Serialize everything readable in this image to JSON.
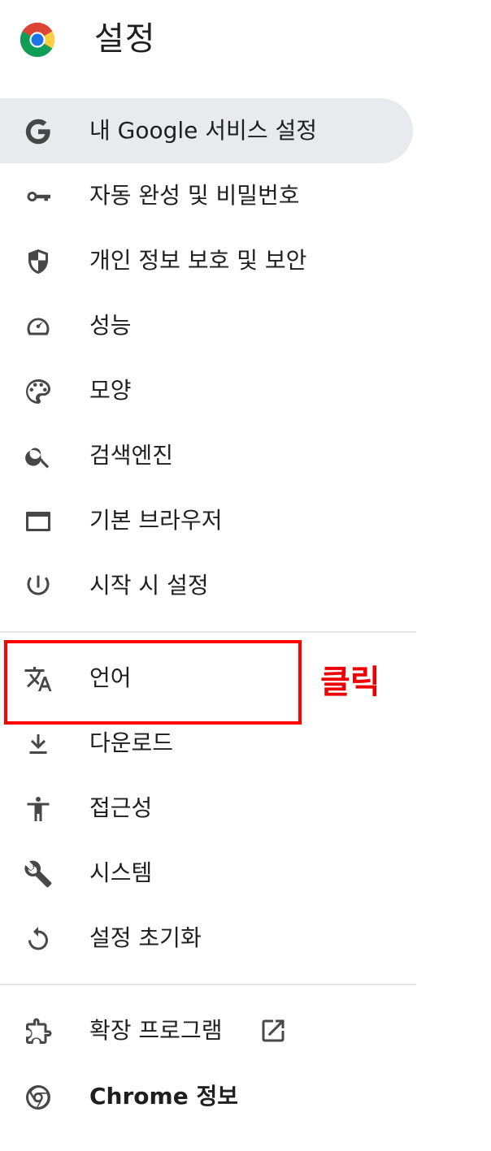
{
  "header": {
    "title": "설정"
  },
  "nav": {
    "items": [
      {
        "label": "내 Google 서비스 설정",
        "icon": "google-g-icon"
      },
      {
        "label": "자동 완성 및 비밀번호",
        "icon": "key-icon"
      },
      {
        "label": "개인 정보 보호 및 보안",
        "icon": "shield-icon"
      },
      {
        "label": "성능",
        "icon": "speedometer-icon"
      },
      {
        "label": "모양",
        "icon": "palette-icon"
      },
      {
        "label": "검색엔진",
        "icon": "search-icon"
      },
      {
        "label": "기본 브라우저",
        "icon": "browser-window-icon"
      },
      {
        "label": "시작 시 설정",
        "icon": "power-icon"
      },
      {
        "label": "언어",
        "icon": "translate-icon"
      },
      {
        "label": "다운로드",
        "icon": "download-icon"
      },
      {
        "label": "접근성",
        "icon": "accessibility-icon"
      },
      {
        "label": "시스템",
        "icon": "wrench-icon"
      },
      {
        "label": "설정 초기화",
        "icon": "reset-icon"
      },
      {
        "label": "확장 프로그램",
        "icon": "extension-icon"
      },
      {
        "label": "Chrome 정보",
        "icon": "chrome-icon"
      }
    ]
  },
  "annotation": {
    "text": "클릭",
    "color": "#ff0000"
  },
  "colors": {
    "active_bg": "#e8eaee",
    "icon": "#474747",
    "divider": "#e3e3e3"
  }
}
